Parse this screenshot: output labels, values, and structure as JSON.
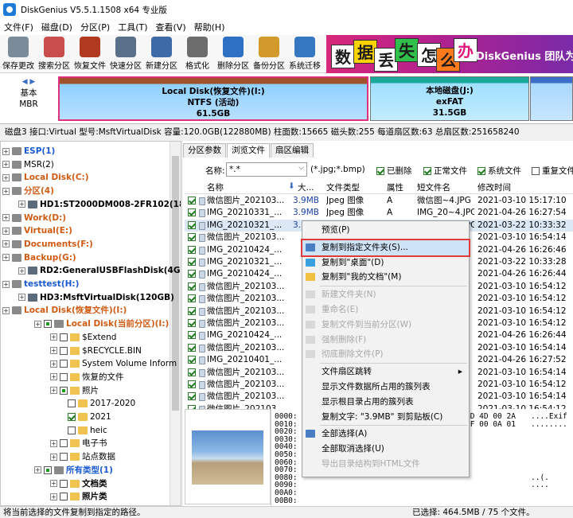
{
  "window": {
    "title": "DiskGenius V5.5.1.1508 x64 专业版"
  },
  "menu": [
    "文件(F)",
    "磁盘(D)",
    "分区(P)",
    "工具(T)",
    "查看(V)",
    "帮助(H)"
  ],
  "toolbar": [
    {
      "label": "保存更改",
      "color": "#7a8b99",
      "icon": "save-icon"
    },
    {
      "label": "搜索分区",
      "color": "#c84e4e",
      "icon": "search-partition-icon"
    },
    {
      "label": "恢复文件",
      "color": "#b0391f",
      "icon": "recover-file-icon"
    },
    {
      "label": "快速分区",
      "color": "#5a6f89",
      "icon": "quick-partition-icon"
    },
    {
      "label": "新建分区",
      "color": "#3f6aa8",
      "icon": "new-partition-icon"
    },
    {
      "label": "格式化",
      "color": "#6d6d6d",
      "icon": "format-icon"
    },
    {
      "label": "删除分区",
      "color": "#2d70c4",
      "icon": "delete-partition-icon"
    },
    {
      "label": "备份分区",
      "color": "#d19a2a",
      "icon": "backup-partition-icon"
    },
    {
      "label": "系统迁移",
      "color": "#3577c0",
      "icon": "system-migrate-icon"
    }
  ],
  "banner": {
    "chars": [
      "数",
      "据",
      "丢",
      "失",
      "怎",
      "么",
      "办"
    ],
    "text": "DiskGenius 团队为您"
  },
  "diskbar": {
    "basic": [
      "基本",
      "MBR"
    ],
    "parts": [
      {
        "name": "Local Disk(恢复文件)(I:)",
        "fs": "NTFS (活动)",
        "size": "61.5GB"
      },
      {
        "name": "本地磁盘(J:)",
        "fs": "exFAT",
        "size": "31.5GB"
      }
    ]
  },
  "diskinfo": "磁盘3 接口:Virtual  型号:MsftVirtualDisk  容量:120.0GB(122880MB)  柱面数:15665  磁头数:255  每道扇区数:63  总扇区数:251658240",
  "tree": [
    {
      "label": "ESP(1)",
      "depth": 1,
      "style": "b"
    },
    {
      "label": "MSR(2)",
      "depth": 1,
      "style": "n"
    },
    {
      "label": "Local Disk(C:)",
      "depth": 1,
      "style": "p"
    },
    {
      "label": "分区(4)",
      "depth": 1,
      "style": "p"
    },
    {
      "label": "HD1:ST2000DM008-2FR102(1863G",
      "depth": 0,
      "style": "k"
    },
    {
      "label": "Work(D:)",
      "depth": 1,
      "style": "p"
    },
    {
      "label": "Virtual(E:)",
      "depth": 1,
      "style": "p"
    },
    {
      "label": "Documents(F:)",
      "depth": 1,
      "style": "p"
    },
    {
      "label": "Backup(G:)",
      "depth": 1,
      "style": "p"
    },
    {
      "label": "RD2:GeneralUSBFlashDisk(4GB)",
      "depth": 0,
      "style": "k"
    },
    {
      "label": "testtest(H:)",
      "depth": 1,
      "style": "t"
    },
    {
      "label": "HD3:MsftVirtualDisk(120GB)",
      "depth": 0,
      "style": "k"
    },
    {
      "label": "Local Disk(恢复文件)(I:)",
      "depth": 1,
      "style": "p"
    },
    {
      "label": "Local Disk(当前分区)(I:)",
      "depth": 2,
      "style": "p"
    },
    {
      "label": "$Extend",
      "depth": 3,
      "style": "n"
    },
    {
      "label": "$RECYCLE.BIN",
      "depth": 3,
      "style": "n"
    },
    {
      "label": "System Volume Inform",
      "depth": 3,
      "style": "n"
    },
    {
      "label": "恢复的文件",
      "depth": 3,
      "style": "n"
    },
    {
      "label": "照片",
      "depth": 3,
      "style": "n"
    },
    {
      "label": "2017-2020",
      "depth": 4,
      "style": "n"
    },
    {
      "label": "2021",
      "depth": 4,
      "style": "n"
    },
    {
      "label": "heic",
      "depth": 4,
      "style": "n"
    },
    {
      "label": "电子书",
      "depth": 3,
      "style": "n"
    },
    {
      "label": "站点数据",
      "depth": 3,
      "style": "n"
    },
    {
      "label": "所有类型(1)",
      "depth": 2,
      "style": "b"
    },
    {
      "label": "文档类",
      "depth": 3,
      "style": "k"
    },
    {
      "label": "照片类",
      "depth": 3,
      "style": "k"
    }
  ],
  "tabs": [
    "分区参数",
    "浏览文件",
    "扇区编辑"
  ],
  "filter": {
    "label": "名称:",
    "value": "*.*",
    "hint": "(*.jpg;*.bmp)",
    "opts": [
      "已删除",
      "正常文件",
      "系统文件",
      "重复文件"
    ]
  },
  "columns": [
    "名称",
    "大...",
    "文件类型",
    "属性",
    "短文件名",
    "修改时间"
  ],
  "files": [
    {
      "name": "微信图片_202103...",
      "size": "3.9MB",
      "type": "Jpeg 图像",
      "attr": "A",
      "short": "微信图~4.JPG",
      "time": "2021-03-10 15:17:10"
    },
    {
      "name": "IMG_20210331_...",
      "size": "3.9MB",
      "type": "Jpeg 图像",
      "attr": "A",
      "short": "IMG_20~4.JPG",
      "time": "2021-04-26 16:27:54"
    },
    {
      "name": "IMG_20210321_...",
      "size": "3.3MB",
      "type": "Jpeg 图像",
      "attr": "A",
      "short": "IMG_20~1.JPG",
      "time": "2021-03-22 10:33:32"
    },
    {
      "name": "微信图片_202103...",
      "size": "",
      "type": "",
      "attr": "",
      "short": "",
      "time": "2021-03-10 16:54:14"
    },
    {
      "name": "IMG_20210424_...",
      "size": "",
      "type": "",
      "attr": "",
      "short": "",
      "time": "2021-04-26 16:26:46"
    },
    {
      "name": "IMG_20210321_...",
      "size": "",
      "type": "",
      "attr": "",
      "short": "",
      "time": "2021-03-22 10:33:28"
    },
    {
      "name": "IMG_20210424_...",
      "size": "",
      "type": "",
      "attr": "",
      "short": "",
      "time": "2021-04-26 16:26:44"
    },
    {
      "name": "微信图片_202103...",
      "size": "",
      "type": "",
      "attr": "",
      "short": "",
      "time": "2021-03-10 16:54:12"
    },
    {
      "name": "微信图片_202103...",
      "size": "",
      "type": "",
      "attr": "",
      "short": "",
      "time": "2021-03-10 16:54:12"
    },
    {
      "name": "微信图片_202103...",
      "size": "",
      "type": "",
      "attr": "",
      "short": "",
      "time": "2021-03-10 16:54:12"
    },
    {
      "name": "微信图片_202103...",
      "size": "",
      "type": "",
      "attr": "",
      "short": "",
      "time": "2021-03-10 16:54:12"
    },
    {
      "name": "IMG_20210424_...",
      "size": "",
      "type": "",
      "attr": "",
      "short": "",
      "time": "2021-04-26 16:26:44"
    },
    {
      "name": "微信图片_202103...",
      "size": "",
      "type": "",
      "attr": "",
      "short": "",
      "time": "2021-03-10 16:54:14"
    },
    {
      "name": "IMG_20210401_...",
      "size": "",
      "type": "",
      "attr": "",
      "short": "",
      "time": "2021-04-26 16:27:52"
    },
    {
      "name": "微信图片_202103...",
      "size": "",
      "type": "",
      "attr": "",
      "short": "",
      "time": "2021-03-10 16:54:14"
    },
    {
      "name": "微信图片_202103...",
      "size": "",
      "type": "",
      "attr": "",
      "short": "",
      "time": "2021-03-10 16:54:12"
    },
    {
      "name": "微信图片_202103...",
      "size": "",
      "type": "",
      "attr": "",
      "short": "",
      "time": "2021-03-10 16:54:14"
    },
    {
      "name": "微信图片_202103...",
      "size": "",
      "type": "",
      "attr": "",
      "short": "",
      "time": "2021-03-10 16:54:12"
    }
  ],
  "hex": [
    {
      "off": "0000:",
      "tail": "4D 4D 00 2A",
      "ascii": "....Exif"
    },
    {
      "off": "0010:",
      "tail": "0F 00 0A 01",
      "ascii": "........"
    },
    {
      "off": "0020:",
      "tail": "",
      "ascii": ""
    },
    {
      "off": "0030:",
      "tail": "",
      "ascii": ""
    },
    {
      "off": "0040:",
      "tail": "",
      "ascii": ""
    },
    {
      "off": "0050:",
      "tail": "",
      "ascii": ""
    },
    {
      "off": "0060:",
      "tail": "",
      "ascii": ""
    },
    {
      "off": "0070:",
      "tail": "",
      "ascii": ""
    },
    {
      "off": "0080:",
      "tail": "",
      "ascii": "..(."
    },
    {
      "off": "0090:",
      "tail": "",
      "ascii": "...."
    },
    {
      "off": "00A0:",
      "tail": "",
      "ascii": ""
    },
    {
      "off": "00B0:",
      "tail": "",
      "ascii": ""
    }
  ],
  "context_menu": [
    {
      "label": "预览(P)",
      "dis": false,
      "sep_after": true
    },
    {
      "label": "复制到指定文件夹(S)...",
      "dis": false,
      "hl": true
    },
    {
      "label": "复制到\"桌面\"(D)",
      "dis": false
    },
    {
      "label": "复制到\"我的文档\"(M)",
      "dis": false,
      "sep_after": true
    },
    {
      "label": "新建文件夹(N)",
      "dis": true
    },
    {
      "label": "重命名(E)",
      "dis": true
    },
    {
      "label": "复制文件到当前分区(W)",
      "dis": true
    },
    {
      "label": "强制删除(F)",
      "dis": true
    },
    {
      "label": "彻底删除文件(P)",
      "dis": true,
      "sep_after": true
    },
    {
      "label": "文件扇区跳转",
      "dis": false,
      "arrow": true
    },
    {
      "label": "显示文件数据所占用的簇列表",
      "dis": false
    },
    {
      "label": "显示根目录占用的簇列表",
      "dis": false
    },
    {
      "label": "复制文字: \"3.9MB\" 到剪贴板(C)",
      "dis": false,
      "sep_after": true
    },
    {
      "label": "全部选择(A)",
      "dis": false
    },
    {
      "label": "全部取消选择(U)",
      "dis": false
    },
    {
      "label": "导出目录结构到HTML文件",
      "dis": true
    }
  ],
  "status": {
    "left": "将当前选择的文件复制到指定的路径。",
    "right": "已选择: 464.5MB / 75 个文件。"
  }
}
